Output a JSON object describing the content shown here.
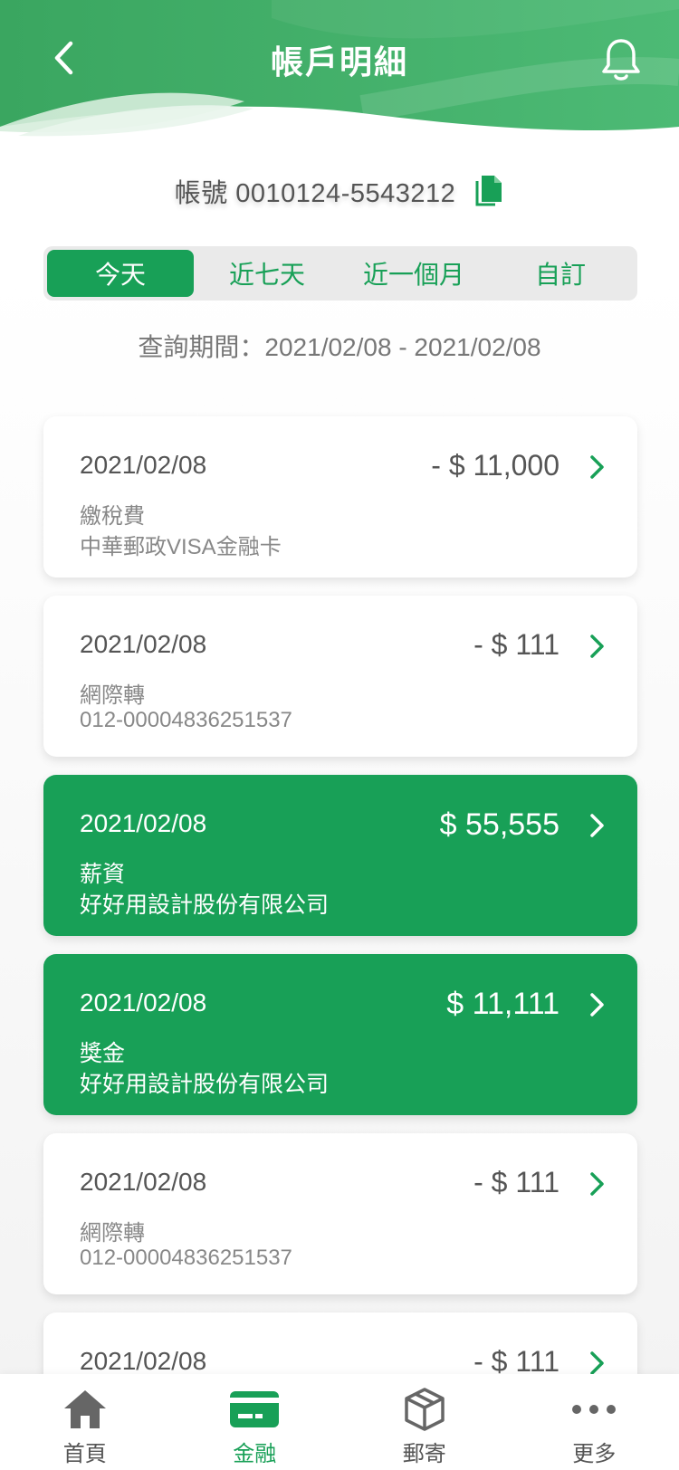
{
  "header": {
    "title": "帳戶明細"
  },
  "account": {
    "label": "帳號 0010124-5543212"
  },
  "tabs": [
    {
      "label": "今天",
      "active": true
    },
    {
      "label": "近七天",
      "active": false
    },
    {
      "label": "近一個月",
      "active": false
    },
    {
      "label": "自訂",
      "active": false
    }
  ],
  "period": "查詢期間：2021/02/08 - 2021/02/08",
  "transactions": [
    {
      "date": "2021/02/08",
      "amount": "- $ 11,000",
      "desc": "繳稅費",
      "detail": "中華郵政VISA金融卡",
      "type": "expense"
    },
    {
      "date": "2021/02/08",
      "amount": "- $ 111",
      "desc": "網際轉",
      "detail": "012-00004836251537",
      "type": "expense"
    },
    {
      "date": "2021/02/08",
      "amount": "$ 55,555",
      "desc": "薪資",
      "detail": "好好用設計股份有限公司",
      "type": "income"
    },
    {
      "date": "2021/02/08",
      "amount": "$ 11,111",
      "desc": "獎金",
      "detail": "好好用設計股份有限公司",
      "type": "income"
    },
    {
      "date": "2021/02/08",
      "amount": "- $ 111",
      "desc": "網際轉",
      "detail": "012-00004836251537",
      "type": "expense"
    },
    {
      "date": "2021/02/08",
      "amount": "- $ 111",
      "desc": "",
      "detail": "",
      "type": "expense"
    }
  ],
  "nav": [
    {
      "label": "首頁",
      "icon": "home-icon",
      "active": false
    },
    {
      "label": "金融",
      "icon": "card-icon",
      "active": true
    },
    {
      "label": "郵寄",
      "icon": "package-icon",
      "active": false
    },
    {
      "label": "更多",
      "icon": "more-icon",
      "active": false
    }
  ],
  "colors": {
    "brand": "#18a057",
    "header_green": "#3daa63"
  }
}
